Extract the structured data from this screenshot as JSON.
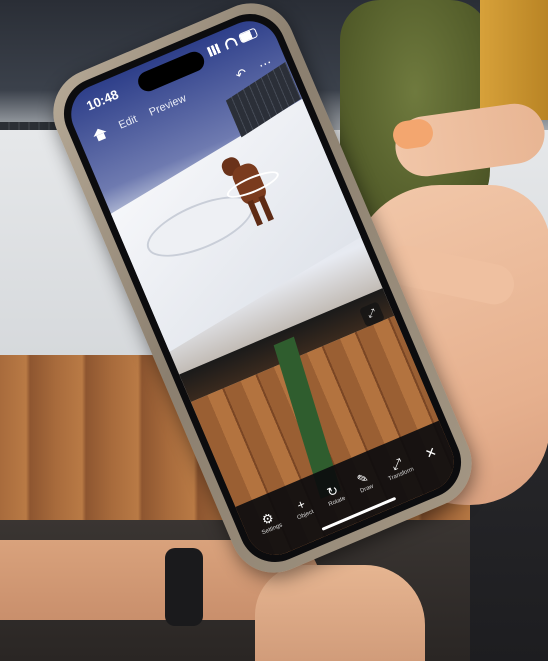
{
  "status_bar": {
    "time": "10:48"
  },
  "app_bar": {
    "icons": {
      "home": "home-icon",
      "undo": "undo-icon",
      "more": "more-icon"
    },
    "tabs": [
      {
        "label": "Edit"
      },
      {
        "label": "Preview"
      }
    ]
  },
  "toolbar": {
    "items": [
      {
        "icon": "⚙",
        "label": "Settings"
      },
      {
        "icon": "+",
        "label": "Object"
      },
      {
        "icon": "↻",
        "label": "Rotate"
      },
      {
        "icon": "✎",
        "label": "Draw"
      },
      {
        "icon": "⤢",
        "label": "Transform"
      },
      {
        "icon": "✕",
        "label": ""
      }
    ]
  },
  "colors": {
    "screen_sky": "#2e3f8a",
    "horse": "#7a3b1e",
    "phone_case": "#b7aa97"
  }
}
